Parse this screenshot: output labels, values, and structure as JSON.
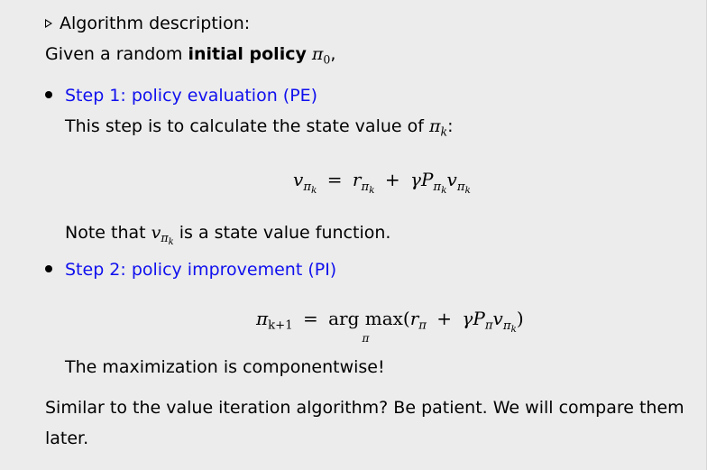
{
  "header": {
    "label": "Algorithm description:"
  },
  "intro": {
    "prefix": "Given a random",
    "bold": "initial policy",
    "symbol": "π",
    "sub": "0",
    "suffix": ","
  },
  "step1": {
    "title": "Step 1: policy evaluation (PE)",
    "desc_prefix": "This step is to calculate the state value of",
    "desc_sym": "π",
    "desc_sub": "k",
    "desc_suffix": ":",
    "note_prefix": "Note that",
    "note_sym": "v",
    "note_sub1": "π",
    "note_sub2": "k",
    "note_suffix": "is a state value function."
  },
  "step2": {
    "title": "Step 2: policy improvement (PI)",
    "remark": "The maximization is componentwise!"
  },
  "closing": {
    "line1": "Similar to the value iteration algorithm? Be patient. We will compare them",
    "line2": "later."
  },
  "equations": {
    "pe": {
      "v": "v",
      "eq": "=",
      "r": "r",
      "plus": "+",
      "gamma": "γ",
      "P": "P",
      "v2": "v",
      "pi": "π",
      "k": "k"
    },
    "pi": {
      "lhs": "π",
      "lhs_sub": "k+1",
      "eq": "=",
      "arg": "arg max",
      "under": "π",
      "open": "(",
      "r": "r",
      "plus": "+",
      "gamma": "γ",
      "P": "P",
      "v": "v",
      "pi": "π",
      "k": "k",
      "close": ")"
    }
  }
}
